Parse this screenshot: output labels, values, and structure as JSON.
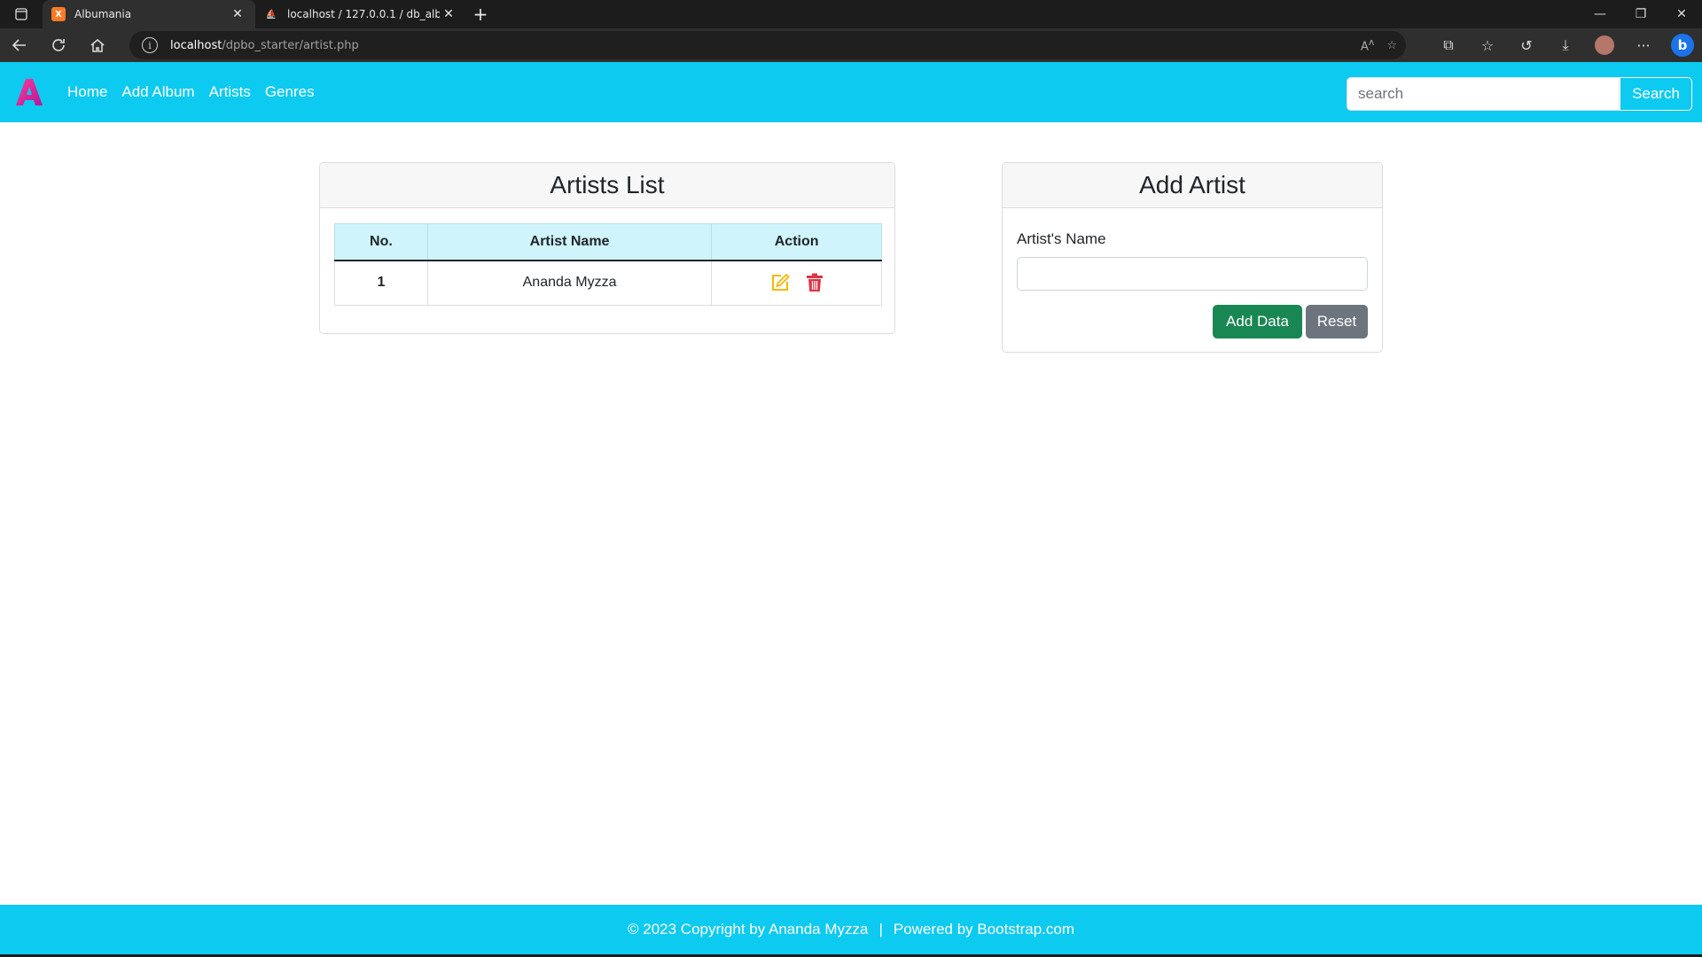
{
  "browser": {
    "tabs": [
      {
        "title": "Albumania",
        "active": true
      },
      {
        "title": "localhost / 127.0.0.1 / db_album",
        "active": false
      }
    ],
    "url_host": "localhost",
    "url_path": "/dpbo_starter/artist.php"
  },
  "navbar": {
    "links": [
      "Home",
      "Add Album",
      "Artists",
      "Genres"
    ],
    "search_placeholder": "search",
    "search_button": "Search"
  },
  "artists_list": {
    "title": "Artists List",
    "columns": [
      "No.",
      "Artist Name",
      "Action"
    ],
    "rows": [
      {
        "no": "1",
        "name": "Ananda Myzza"
      }
    ]
  },
  "add_artist": {
    "title": "Add Artist",
    "field_label": "Artist's Name",
    "field_value": "",
    "add_button": "Add Data",
    "reset_button": "Reset"
  },
  "footer": {
    "copyright": "© 2023 Copyright by Ananda Myzza",
    "separator": "|",
    "powered": "Powered by Bootstrap.com"
  },
  "colors": {
    "navbar": "#0dcaf0",
    "add_button": "#198754",
    "reset_button": "#6c757d",
    "edit_icon": "#f5b800",
    "delete_icon": "#dc3545"
  }
}
